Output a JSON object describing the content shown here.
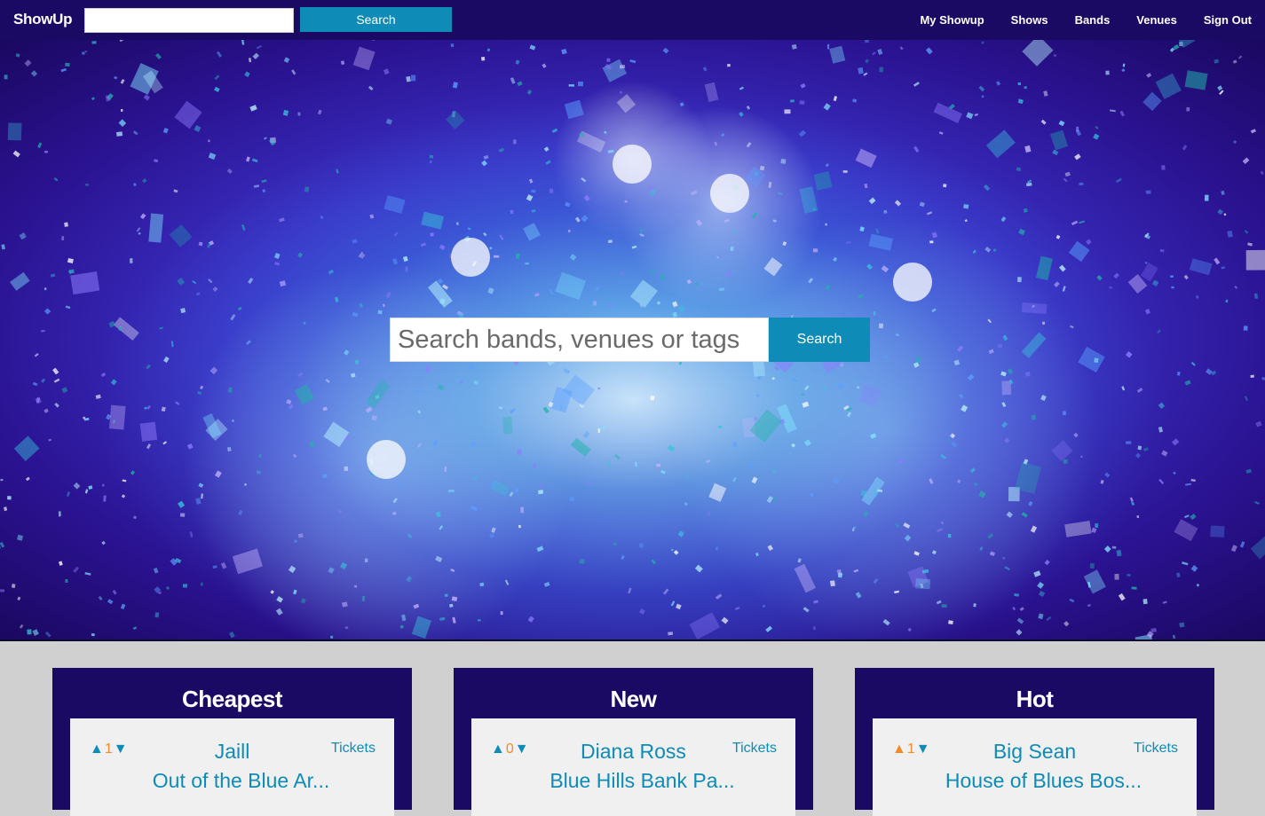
{
  "app": {
    "brand": "ShowUp"
  },
  "topbar": {
    "search_value": "",
    "search_button": "Search",
    "nav": [
      "My Showup",
      "Shows",
      "Bands",
      "Venues",
      "Sign Out"
    ]
  },
  "hero": {
    "search_placeholder": "Search bands, venues or tags",
    "search_button": "Search"
  },
  "panels": [
    {
      "title": "Cheapest",
      "up": "▲",
      "down": "▼",
      "votes": "1",
      "votes_color": "#f08a2a",
      "up_color": "#0e8bb6",
      "band": "Jaill",
      "tickets": "Tickets",
      "venue": "Out of the Blue Ar..."
    },
    {
      "title": "New",
      "up": "▲",
      "down": "▼",
      "votes": "0",
      "votes_color": "#f08a2a",
      "up_color": "#0e8bb6",
      "band": "Diana Ross",
      "tickets": "Tickets",
      "venue": "Blue Hills Bank Pa..."
    },
    {
      "title": "Hot",
      "up": "▲",
      "down": "▼",
      "votes": "1",
      "votes_color": "#f08a2a",
      "up_color": "#f08a2a",
      "band": "Big Sean",
      "tickets": "Tickets",
      "venue": "House of Blues Bos..."
    }
  ],
  "colors": {
    "navy": "#1b0a64",
    "accent": "#0e8bb6",
    "vote": "#f08a2a"
  }
}
